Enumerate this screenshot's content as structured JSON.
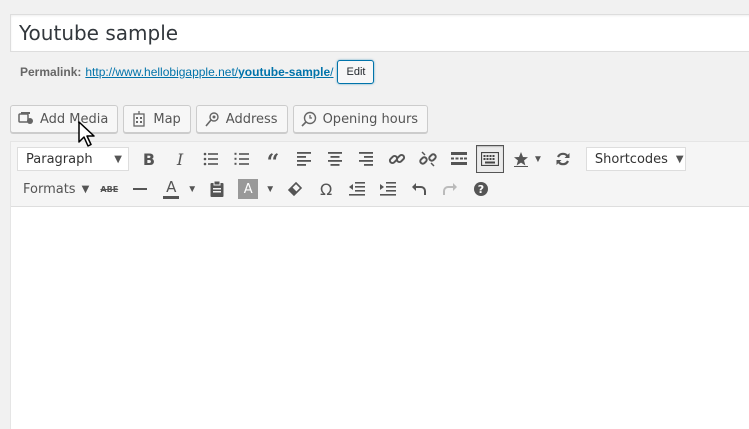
{
  "post": {
    "title": "Youtube sample",
    "permalink_label": "Permalink:",
    "permalink_base": "http://www.hellobigapple.net/",
    "permalink_slug": "youtube-sample",
    "permalink_trail": "/",
    "edit_label": "Edit"
  },
  "media_buttons": [
    {
      "label": "Add Media",
      "icon": "add-media-icon"
    },
    {
      "label": "Map",
      "icon": "map-icon"
    },
    {
      "label": "Address",
      "icon": "address-icon"
    },
    {
      "label": "Opening hours",
      "icon": "clock-icon"
    }
  ],
  "toolbar": {
    "paragraph_select": "Paragraph",
    "shortcodes_select": "Shortcodes",
    "formats_label": "Formats",
    "strikethrough_glyph": "ABE",
    "text_color_glyph": "A",
    "bg_color_glyph": "A",
    "omega_glyph": "Ω"
  },
  "colors": {
    "link": "#0073aa",
    "toolbar_bg": "#f5f5f5",
    "icon": "#555555"
  }
}
